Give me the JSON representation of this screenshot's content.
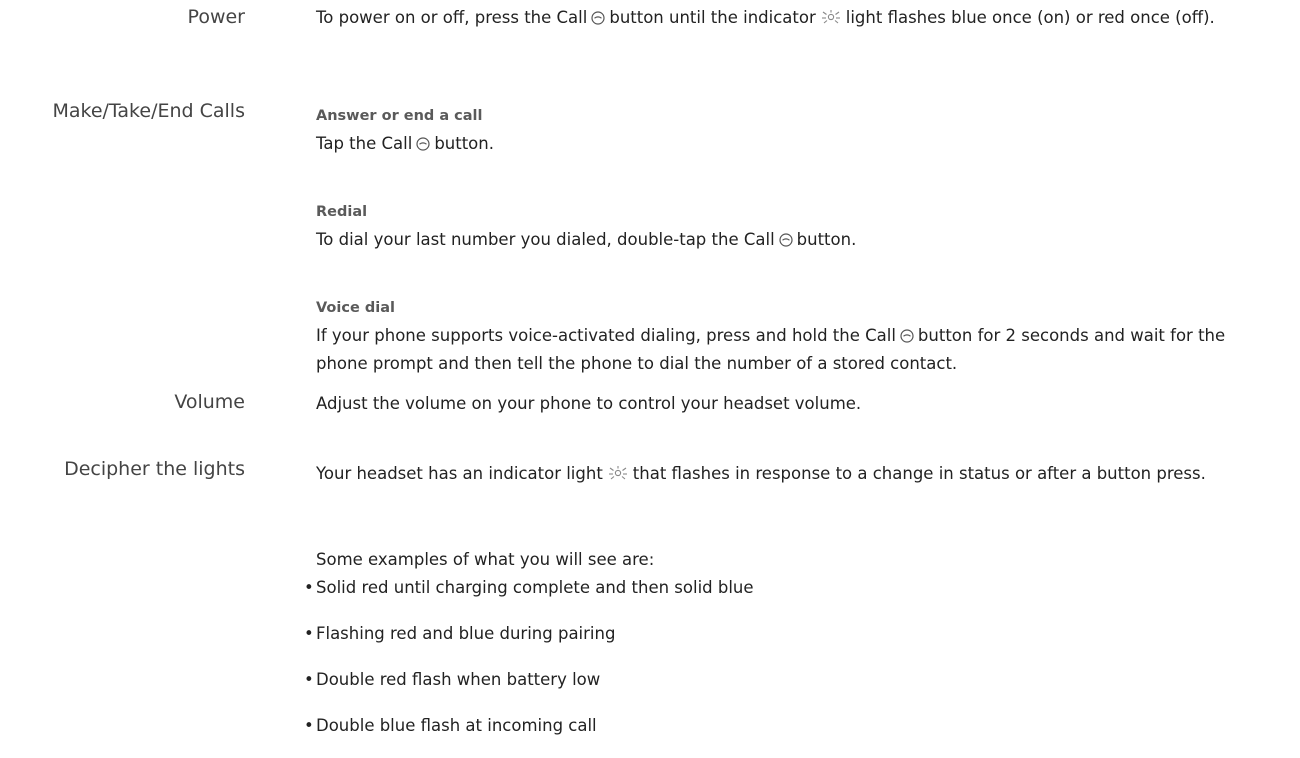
{
  "power": {
    "title": "Power",
    "text_a": "To power on or off, press the Call",
    "text_b": "button until the indicator",
    "text_c": "light flashes blue once (on) or red once (off)."
  },
  "calls": {
    "title": "Make/Take/End Calls",
    "answer": {
      "heading": "Answer or end a call",
      "text_a": "Tap the Call",
      "text_b": "button."
    },
    "redial": {
      "heading": "Redial",
      "text_a": "To dial your last number you dialed, double-tap the Call",
      "text_b": "button."
    },
    "voice": {
      "heading": "Voice dial",
      "text_a": "If your phone supports voice-activated dialing, press and hold the Call",
      "text_b": "button for 2 seconds and wait for the phone prompt and then tell the phone to dial the number of a stored contact."
    }
  },
  "volume": {
    "title": "Volume",
    "text": "Adjust the volume on your phone to control your headset volume."
  },
  "lights": {
    "title": "Decipher the lights",
    "text_a": "Your headset has an indicator light",
    "text_b": "that flashes in response to a change in status or after a button press.",
    "intro": "Some examples of what you will see are:",
    "bullets": [
      "Solid red until charging complete and then solid blue",
      "Flashing red and blue during pairing",
      "Double red flash when battery low",
      "Double blue flash at incoming call"
    ]
  },
  "icons": {
    "call": "call-button-icon",
    "light": "indicator-light-icon"
  }
}
